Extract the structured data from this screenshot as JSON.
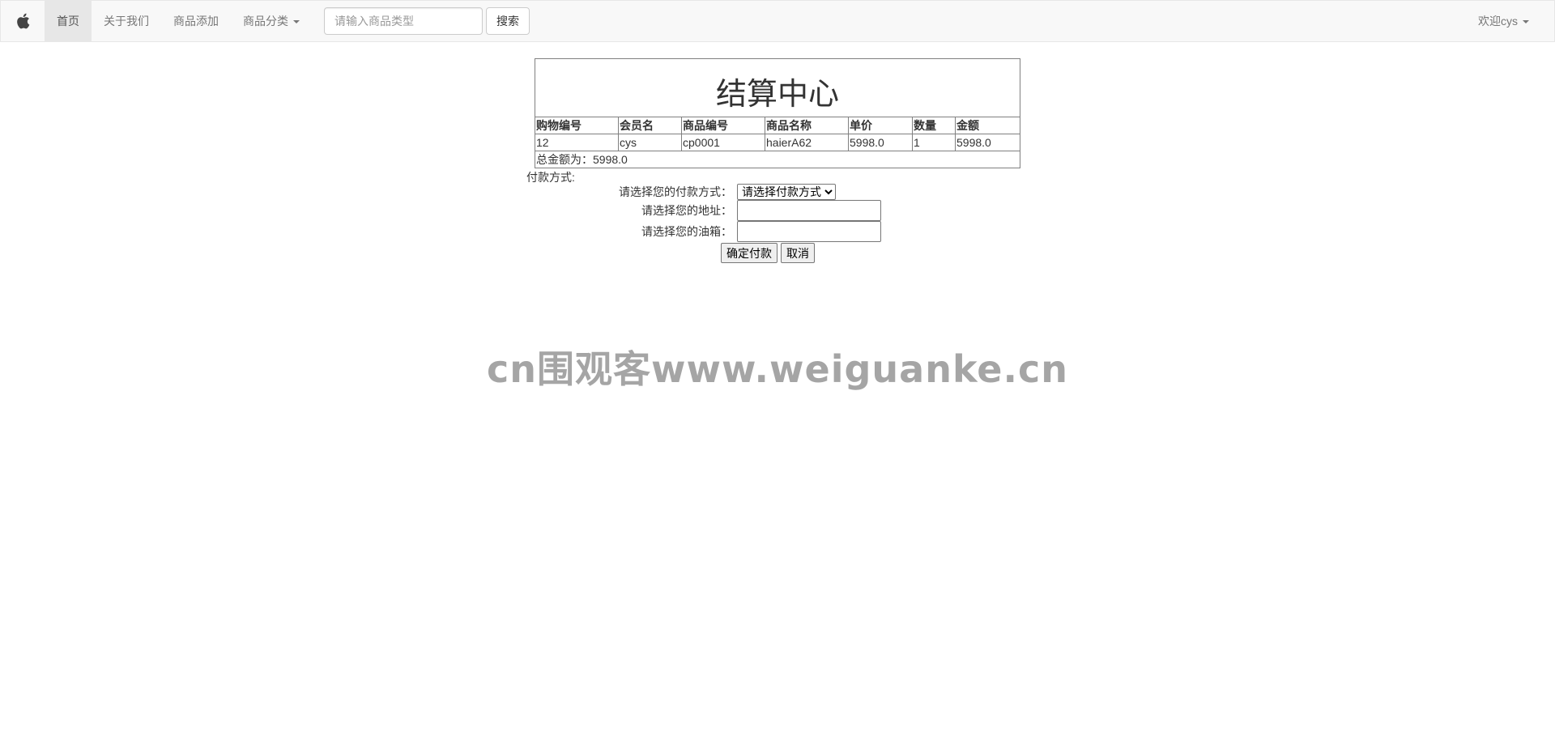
{
  "navbar": {
    "brand_icon": "apple-icon",
    "items": [
      {
        "label": "首页",
        "active": true
      },
      {
        "label": "关于我们"
      },
      {
        "label": "商品添加"
      },
      {
        "label": "商品分类",
        "dropdown": true
      }
    ],
    "search": {
      "placeholder": "请输入商品类型",
      "button_label": "搜索"
    },
    "user_menu": "欢迎cys"
  },
  "checkout": {
    "title": "结算中心",
    "headers": [
      "购物编号",
      "会员名",
      "商品编号",
      "商品名称",
      "单价",
      "数量",
      "金额"
    ],
    "rows": [
      [
        "12",
        "cys",
        "cp0001",
        "haierA62",
        "5998.0",
        "1",
        "5998.0"
      ]
    ],
    "total_text": "总金额为：5998.0"
  },
  "payment": {
    "section_label": "付款方式:",
    "method_label": "请选择您的付款方式：",
    "method_selected": "请选择付款方式",
    "address_label": "请选择您的地址：",
    "email_label": "请选择您的油箱：",
    "confirm_label": "确定付款",
    "cancel_label": "取消"
  },
  "watermark": "cn围观客www.weiguanke.cn"
}
